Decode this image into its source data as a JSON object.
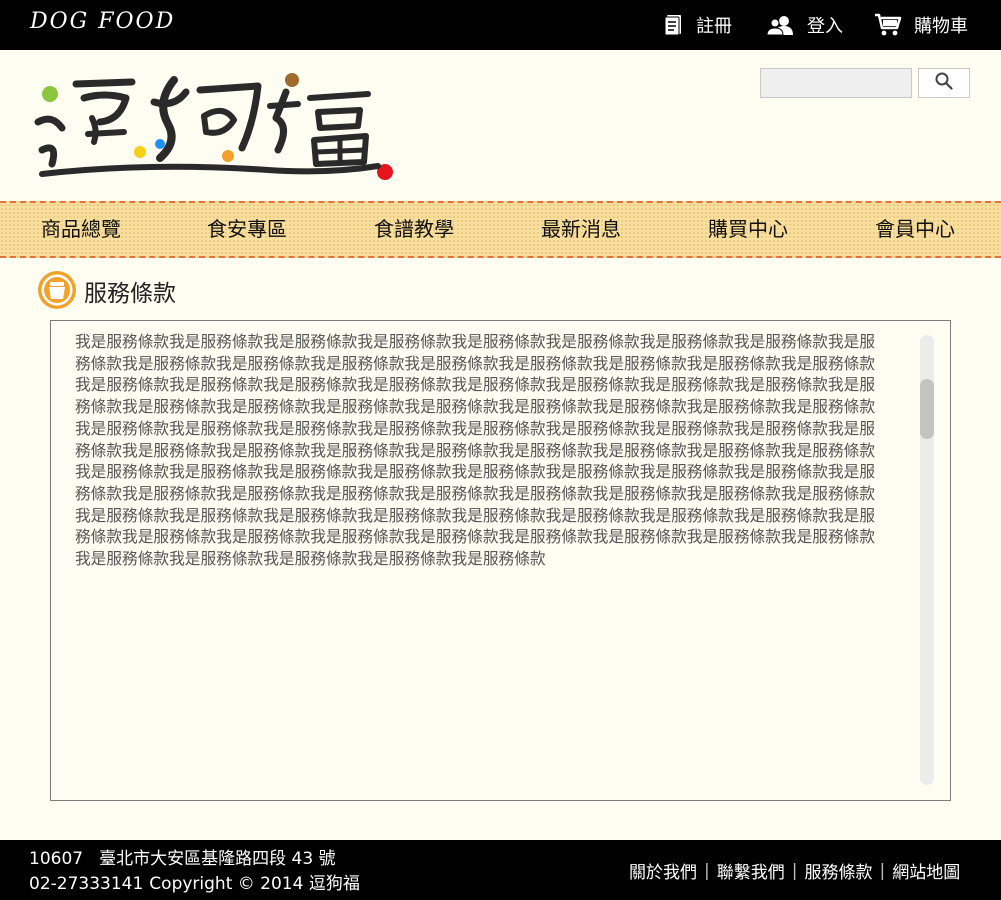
{
  "topbar": {
    "brand": "DOG FOOD",
    "links": [
      {
        "label": "註冊",
        "icon": "register-icon"
      },
      {
        "label": "登入",
        "icon": "login-icon"
      },
      {
        "label": "購物車",
        "icon": "cart-icon"
      }
    ]
  },
  "header": {
    "logo_text": "逗狗福",
    "search": {
      "placeholder": "",
      "button_icon": "search-icon"
    }
  },
  "nav": {
    "items": [
      "商品總覽",
      "食安專區",
      "食譜教學",
      "最新消息",
      "購買中心",
      "會員中心"
    ]
  },
  "section": {
    "title": "服務條款",
    "icon": "badge-icon"
  },
  "terms": {
    "unit": "我是服務條款",
    "repeat": 90
  },
  "footer": {
    "postal_code": "10607",
    "address": "臺北市大安區基隆路四段 43 號",
    "phone": "02-27333141",
    "copyright": "Copyright © 2014 逗狗福",
    "links": [
      "關於我們",
      "聯繫我們",
      "服務條款",
      "網站地圖"
    ]
  },
  "colors": {
    "topbar_bg": "#000000",
    "page_bg": "#fefdf2",
    "nav_bg": "#f8df9e",
    "nav_border": "#e2733a",
    "accent_orange": "#f2a22a"
  }
}
